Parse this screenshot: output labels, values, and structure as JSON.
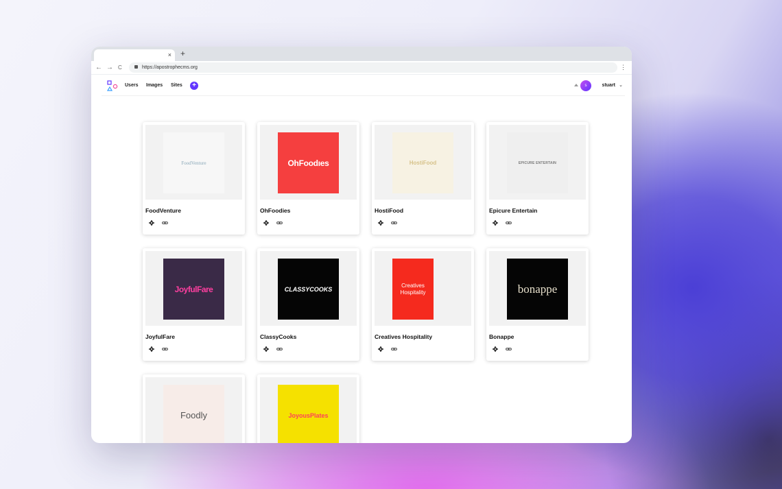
{
  "browser": {
    "tab_close": "×",
    "new_tab": "+",
    "back": "←",
    "forward": "→",
    "reload": "C",
    "url": "https://apostrophecms.org",
    "menu": "⋮"
  },
  "header": {
    "nav": [
      "Users",
      "Images",
      "Sites"
    ],
    "add_label": "+",
    "avatar_initial": "s",
    "username": "stuart",
    "chevron": "⌄"
  },
  "accent_color": "#6236ff",
  "sites": [
    {
      "name": "FoodVenture",
      "logo_text": "FoodVenture",
      "logo_bg": "#f7f7f7",
      "logo_color": "#8aa8b8"
    },
    {
      "name": "OhFoodies",
      "logo_text": "OhFoodıes",
      "logo_bg": "#f53f3f",
      "logo_color": "#ffffff"
    },
    {
      "name": "HostiFood",
      "logo_text": "HostiFood",
      "logo_bg": "#f7f2e3",
      "logo_color": "#d6c28a"
    },
    {
      "name": "Epicure Entertain",
      "logo_text": "EPICURE ENTERTAIN",
      "logo_bg": "#efefef",
      "logo_color": "#777777"
    },
    {
      "name": "JoyfulFare",
      "logo_text": "JoyfulFare",
      "logo_bg": "#3a2a47",
      "logo_color": "#ff3fa0"
    },
    {
      "name": "ClassyCooks",
      "logo_text": "CLASSYCOOKS",
      "logo_bg": "#050505",
      "logo_color": "#ffffff"
    },
    {
      "name": "Creatives Hospitality",
      "logo_text": "Creatives Hospitality",
      "logo_bg": "#f52a1e",
      "logo_color": "#ffffff"
    },
    {
      "name": "Bonappe",
      "logo_text": "bonappe",
      "logo_bg": "#050505",
      "logo_color": "#e8e0cc"
    },
    {
      "name": "",
      "logo_text": "Foodly",
      "logo_bg": "#f7ece8",
      "logo_color": "#555555"
    },
    {
      "name": "",
      "logo_text": "JoyousPlates",
      "logo_bg": "#f5e100",
      "logo_color": "#ff3f5a"
    }
  ]
}
